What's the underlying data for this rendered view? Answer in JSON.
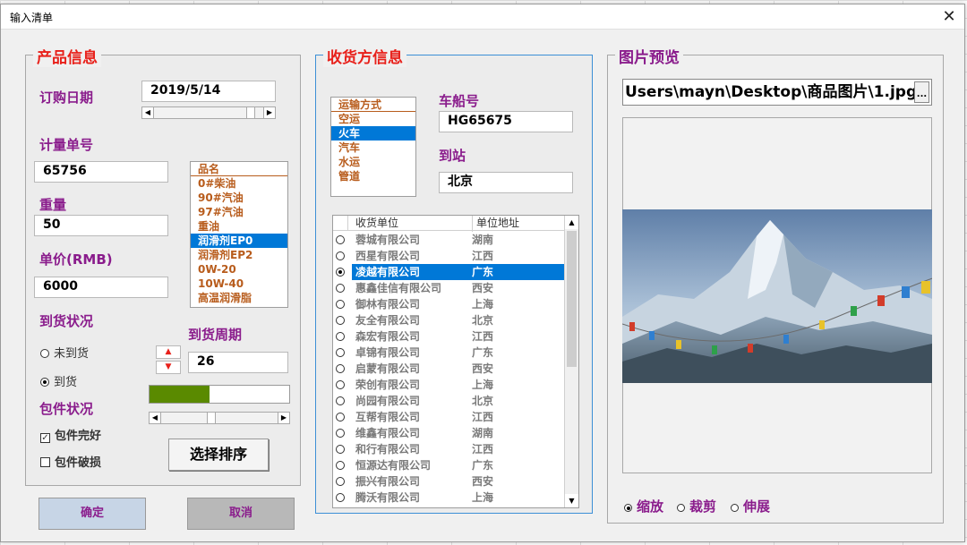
{
  "window": {
    "title": "输入清单",
    "close_glyph": "✕"
  },
  "product": {
    "title": "产品信息",
    "order_date_label": "订购日期",
    "order_date_value": "2019/5/14",
    "measure_no_label": "计量单号",
    "measure_no_value": "65756",
    "weight_label": "重量",
    "weight_value": "50",
    "price_label": "单价(RMB)",
    "price_value": "6000",
    "arrival_status_label": "到货状况",
    "arrival_options": [
      "未到货",
      "到货"
    ],
    "arrival_selected": 1,
    "arrival_cycle_label": "到货周期",
    "arrival_cycle_value": "26",
    "progress_fraction": 0.43,
    "package_status_label": "包件状况",
    "package_options": [
      "包件完好",
      "包件破损"
    ],
    "package_checked": [
      true,
      false
    ],
    "sort_button_label": "选择排序",
    "product_list_header": "品名",
    "product_list": [
      "0#柴油",
      "90#汽油",
      "97#汽油",
      "重油",
      "润滑剂EP0",
      "润滑剂EP2",
      "0W-20",
      "10W-40",
      "高温润滑脂"
    ],
    "product_selected": 4
  },
  "receiver": {
    "title": "收货方信息",
    "transport_header": "运输方式",
    "transport_list": [
      "空运",
      "火车",
      "汽车",
      "水运",
      "管道"
    ],
    "transport_selected": 1,
    "vehicle_no_label": "车船号",
    "vehicle_no_value": "HG65675",
    "destination_label": "到站",
    "destination_value": "北京",
    "grid_headers": [
      "收货单位",
      "单位地址"
    ],
    "grid_rows": [
      [
        "蓉城有限公司",
        "湖南"
      ],
      [
        "西星有限公司",
        "江西"
      ],
      [
        "凌越有限公司",
        "广东"
      ],
      [
        "惠鑫佳信有限公司",
        "西安"
      ],
      [
        "御林有限公司",
        "上海"
      ],
      [
        "友全有限公司",
        "北京"
      ],
      [
        "森宏有限公司",
        "江西"
      ],
      [
        "卓锦有限公司",
        "广东"
      ],
      [
        "启蒙有限公司",
        "西安"
      ],
      [
        "荣创有限公司",
        "上海"
      ],
      [
        "尚园有限公司",
        "北京"
      ],
      [
        "互帮有限公司",
        "江西"
      ],
      [
        "维鑫有限公司",
        "湖南"
      ],
      [
        "和行有限公司",
        "江西"
      ],
      [
        "恒源达有限公司",
        "广东"
      ],
      [
        "振兴有限公司",
        "西安"
      ],
      [
        "腾沃有限公司",
        "上海"
      ]
    ],
    "grid_selected": 2
  },
  "preview": {
    "title": "图片预览",
    "path_value": "Users\\mayn\\Desktop\\商品图片\\1.jpg",
    "browse_label": "...",
    "mode_options": [
      "缩放",
      "裁剪",
      "伸展"
    ],
    "mode_selected": 0
  },
  "footer": {
    "ok_label": "确定",
    "cancel_label": "取消"
  },
  "colors": {
    "frame_title_red": "#e8201a",
    "label_purple": "#8a1c8c",
    "list_brown": "#b85c1c",
    "selection_blue": "#0078d7",
    "progress_green": "#5a8a00"
  }
}
